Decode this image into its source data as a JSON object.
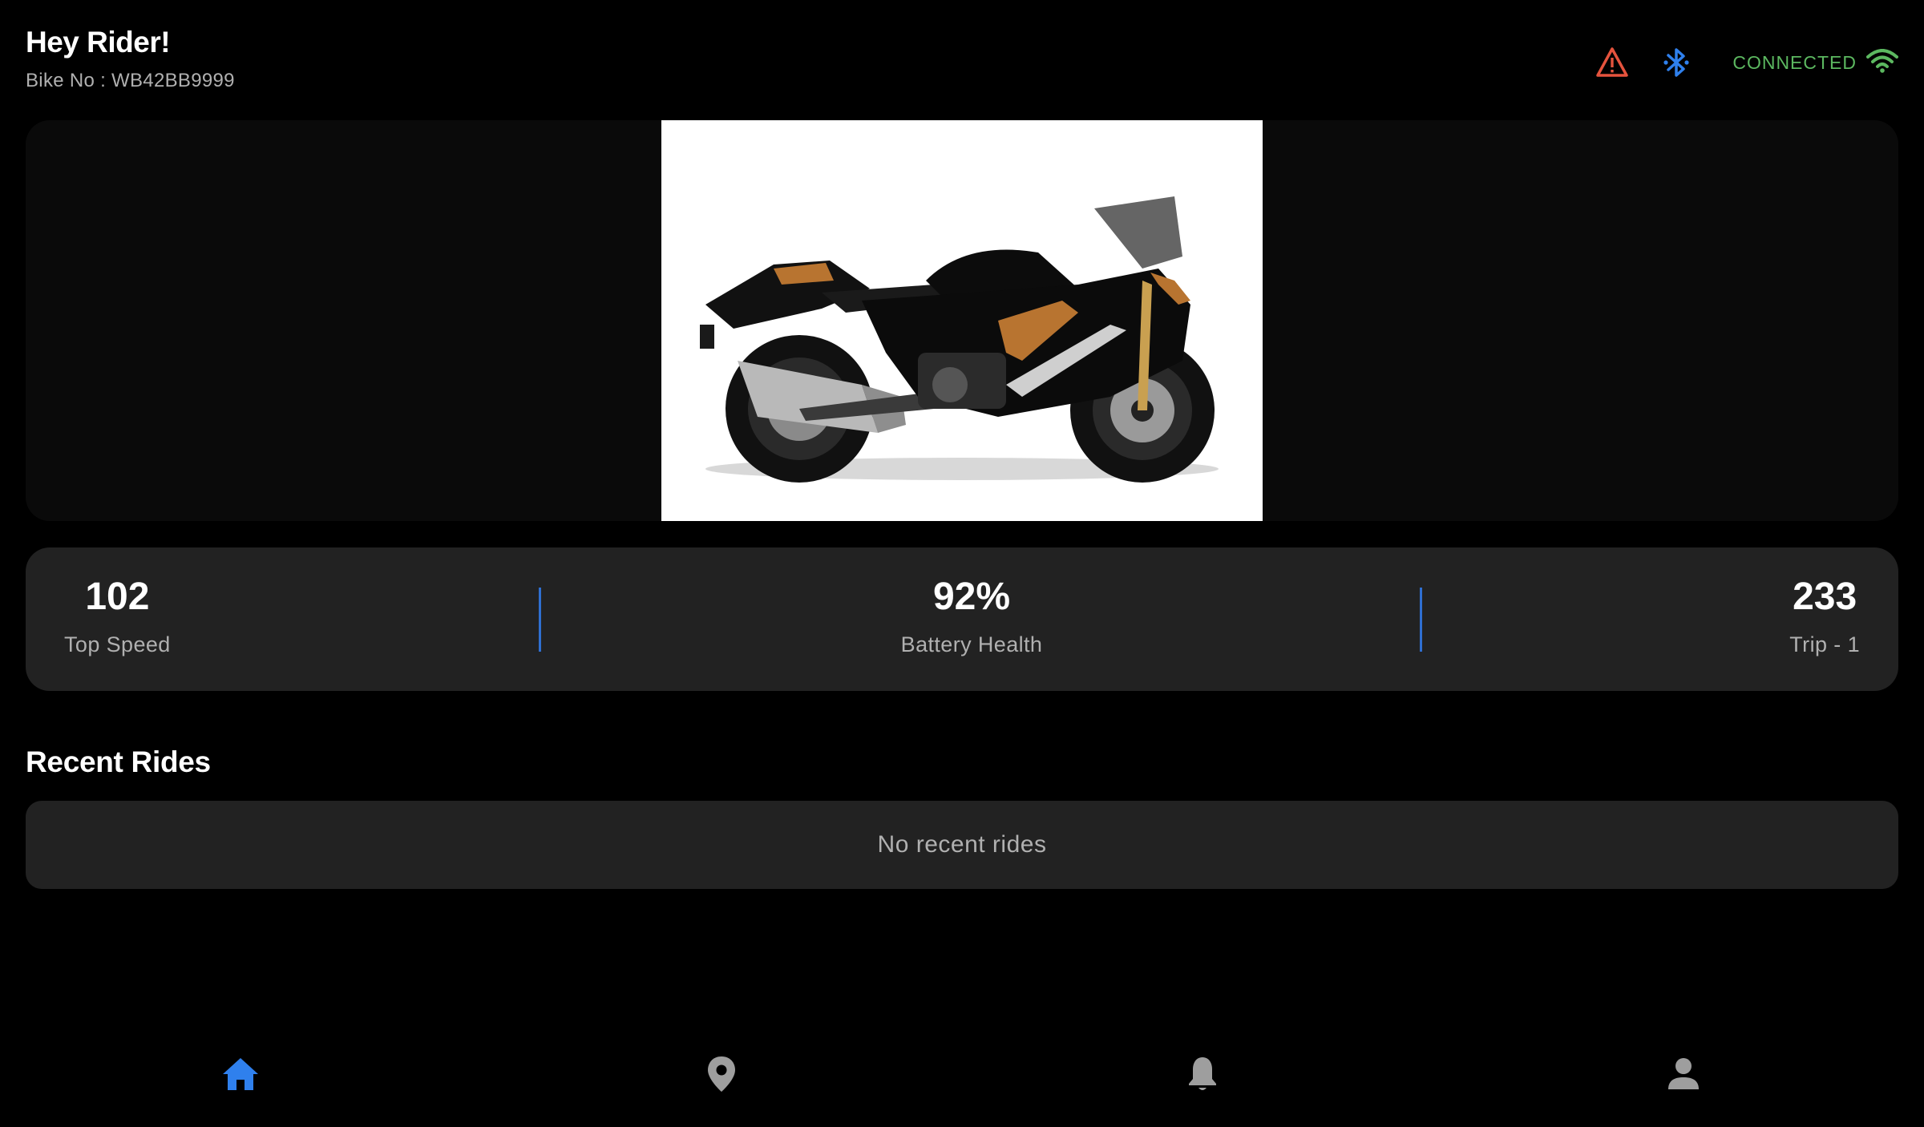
{
  "header": {
    "greeting": "Hey Rider!",
    "bike_no": "Bike No : WB42BB9999",
    "icons": [
      "warning-icon",
      "bluetooth-icon",
      "wifi-icon"
    ],
    "connection_status": "CONNECTED"
  },
  "hero": {
    "image": "motorcycle-photo"
  },
  "stats": [
    {
      "value": "102",
      "label": "Top Speed"
    },
    {
      "value": "92%",
      "label": "Battery Health"
    },
    {
      "value": "233",
      "label": "Trip - 1"
    }
  ],
  "recent_rides": {
    "title": "Recent Rides",
    "empty_text": "No recent rides"
  },
  "bottom_nav": {
    "items": [
      "home-icon",
      "location-pin-icon",
      "bell-icon",
      "person-icon"
    ],
    "active": "home-icon"
  },
  "colors": {
    "background": "#000000",
    "card": "#222222",
    "hero_card": "#0a0a0a",
    "accent_blue": "#2f80ed",
    "warning_red": "#e5533d",
    "connected_green": "#5cb860",
    "inactive_icon": "#9e9e9e"
  }
}
